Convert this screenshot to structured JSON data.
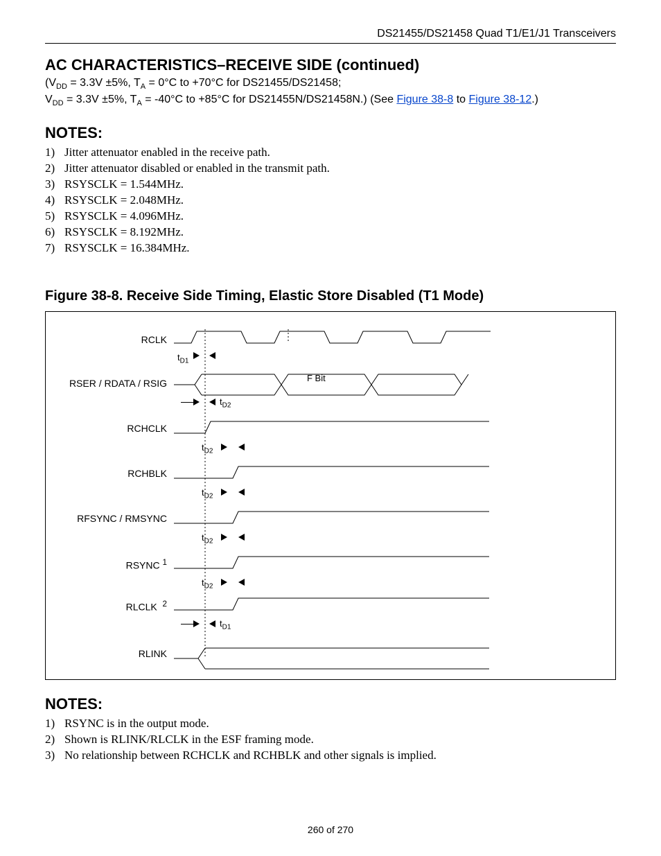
{
  "header": {
    "doc_title": "DS21455/DS21458 Quad T1/E1/J1 Transceivers"
  },
  "section": {
    "title": "AC CHARACTERISTICS–RECEIVE SIDE (continued)",
    "cond_prefix1": "(V",
    "cond_sub_dd": "DD",
    "cond_eq1": " = 3.3V ±5%, T",
    "cond_sub_a": "A",
    "cond_eq2": " = 0°C to +70°C for DS21455/DS21458;",
    "cond_line2a": "V",
    "cond_line2b": " = 3.3V ±5%, T",
    "cond_line2c": " = -40°C to +85°C for DS21455N/DS21458N.) (See ",
    "link1": "Figure 38-8",
    "cond_to": " to ",
    "link2": "Figure 38-12",
    "cond_end": ".)"
  },
  "notes1": {
    "title": "NOTES:",
    "items": [
      "Jitter attenuator enabled in the receive path.",
      "Jitter attenuator disabled or enabled in the transmit path.",
      "RSYSCLK = 1.544MHz.",
      "RSYSCLK = 2.048MHz.",
      "RSYSCLK = 4.096MHz.",
      "RSYSCLK = 8.192MHz.",
      "RSYSCLK = 16.384MHz."
    ]
  },
  "figure": {
    "title": "Figure 38-8. Receive Side Timing, Elastic Store Disabled (T1 Mode)",
    "signals": {
      "rclk": "RCLK",
      "rser": "RSER / RDATA / RSIG",
      "rchclk": "RCHCLK",
      "rchblk": "RCHBLK",
      "rfsync": "RFSYNC / RMSYNC",
      "rsync": "RSYNC",
      "rsync_sup": "1",
      "rlclk": "RLCLK",
      "rlclk_sup": "2",
      "rlink": "RLINK"
    },
    "timing": {
      "td1a": "t",
      "td1b": "D1",
      "td2a": "t",
      "td2b": "D2",
      "fbit": "F Bit"
    }
  },
  "notes2": {
    "title": "NOTES:",
    "items": [
      "RSYNC is in the output mode.",
      "Shown is RLINK/RLCLK in the ESF framing mode.",
      "No relationship between RCHCLK and RCHBLK and other signals is implied."
    ]
  },
  "footer": {
    "page": "260 of 270"
  }
}
